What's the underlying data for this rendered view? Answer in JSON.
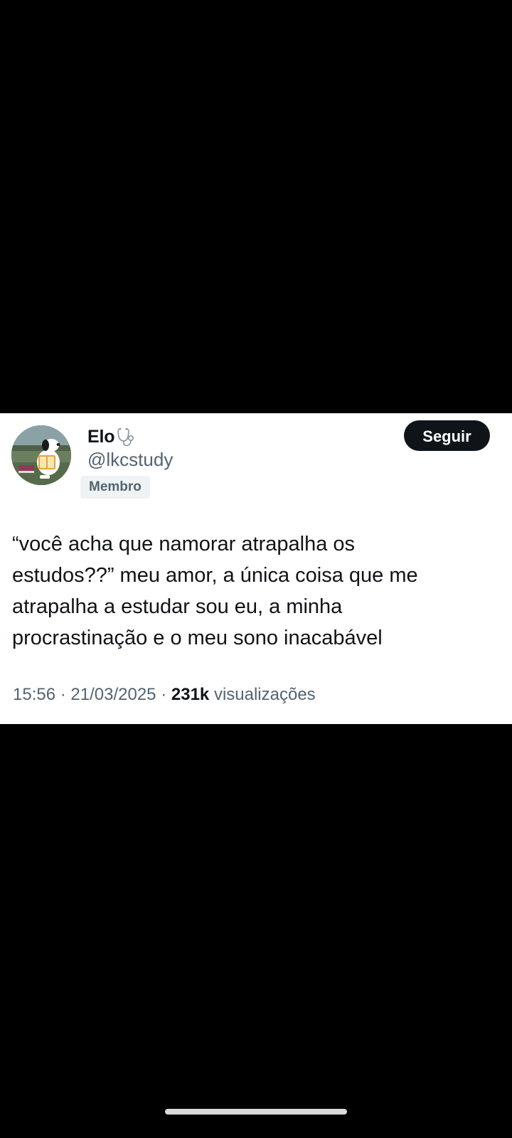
{
  "tweet": {
    "display_name": "Elo",
    "name_emoji": "stethoscope-icon",
    "handle": "@lkcstudy",
    "badge": "Membro",
    "follow_label": "Seguir",
    "text_lines": [
      "“você acha que namorar atrapalha os",
      "estudos??” meu amor, a única coisa que me",
      "atrapalha a estudar sou eu, a minha",
      "procrastinação e o meu sono inacabável"
    ],
    "time": "15:56",
    "separator": "·",
    "date": "21/03/2025",
    "views_count": "231k",
    "views_label": "visualizações"
  },
  "colors": {
    "background": "#000000",
    "card": "#ffffff",
    "primary_text": "#0f1419",
    "secondary_text": "#536471",
    "badge_bg": "#eff3f4",
    "follow_button": "#0f1419"
  }
}
